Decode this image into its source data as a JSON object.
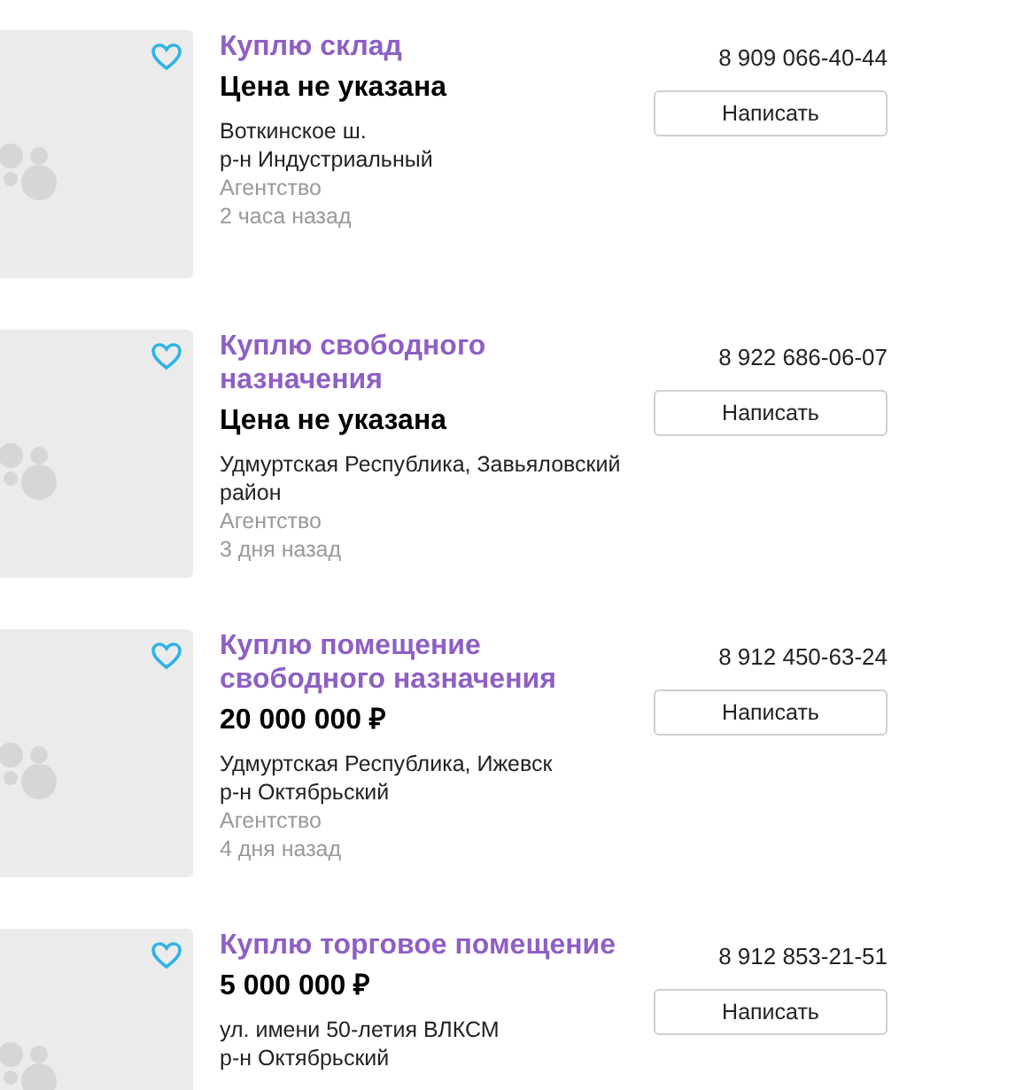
{
  "listings": [
    {
      "title": "Куплю склад",
      "price": "Цена не указана",
      "address": [
        "Воткинское ш.",
        "р-н Индустриальный"
      ],
      "seller": "Агентство",
      "time": "2 часа назад",
      "phone": "8 909 066-40-44",
      "button": "Написать",
      "favorite": false
    },
    {
      "title": "Куплю свободного назначения",
      "price": "Цена не указана",
      "address": [
        "Удмуртская Республика, Завьяловский район"
      ],
      "seller": "Агентство",
      "time": "3 дня назад",
      "phone": "8 922 686-06-07",
      "button": "Написать",
      "favorite": false
    },
    {
      "title": "Куплю помещение свободного назначения",
      "price": "20 000 000 ₽",
      "address": [
        "Удмуртская Республика, Ижевск",
        "р-н Октябрьский"
      ],
      "seller": "Агентство",
      "time": "4 дня назад",
      "phone": "8 912 450-63-24",
      "button": "Написать",
      "favorite": false
    },
    {
      "title": "Куплю торговое помещение",
      "price": "5 000 000 ₽",
      "address": [
        "ул. имени 50-летия ВЛКСМ",
        "р-н Октябрьский"
      ],
      "phone": "8 912 853-21-51",
      "button": "Написать",
      "favorite": false
    }
  ]
}
